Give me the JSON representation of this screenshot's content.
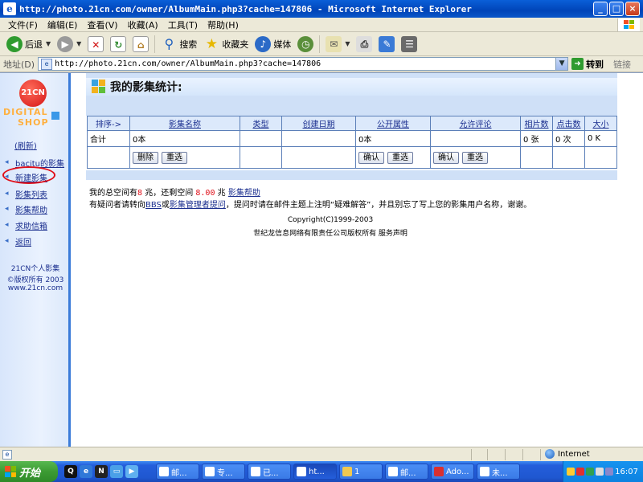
{
  "window": {
    "title": "http://photo.21cn.com/owner/AlbumMain.php3?cache=147806 - Microsoft Internet Explorer"
  },
  "menu": [
    "文件(F)",
    "编辑(E)",
    "查看(V)",
    "收藏(A)",
    "工具(T)",
    "帮助(H)"
  ],
  "toolbar": {
    "back": "后退",
    "search": "搜索",
    "favorites": "收藏夹",
    "media": "媒体"
  },
  "address": {
    "label": "地址(D)",
    "url": "http://photo.21cn.com/owner/AlbumMain.php3?cache=147806",
    "go": "转到",
    "links": "链接"
  },
  "logo": {
    "brand": "21CN",
    "line1": "DIGITAL",
    "line2": "SHOP"
  },
  "sidebar": {
    "refresh": "(刷新)",
    "items": [
      {
        "label": "bacitu的影集"
      },
      {
        "label": "新建影集"
      },
      {
        "label": "影集列表"
      },
      {
        "label": "影集帮助"
      },
      {
        "label": "求助信箱"
      },
      {
        "label": "返回"
      }
    ],
    "footer": [
      "21CN个人影集",
      "©版权所有 2003",
      "www.21cn.com"
    ]
  },
  "main": {
    "title": "我的影集统计:",
    "columns": [
      "排序->",
      "影集名称",
      "类型",
      "创建日期",
      "公开属性",
      "允许评论",
      "相片数",
      "点击数",
      "大小"
    ],
    "summary": {
      "c0": "合计",
      "c1": "0本",
      "c4": "0本",
      "c6": "0 张",
      "c7": "0 次",
      "c8": "0 K"
    },
    "buttons": {
      "delete": "删除",
      "reset": "重选",
      "confirm": "确认"
    },
    "space": {
      "prefix": "我的总空间有",
      "total": "8",
      "mid": " 兆，还剩空间 ",
      "remain": "8.00",
      "suffix": " 兆 ",
      "help_link": "影集帮助"
    },
    "notice": {
      "p1": "有疑问者请转向",
      "bbs": "BBS",
      "p2": "或",
      "admin": "影集管理者提问",
      "p3": "，提问时请在邮件主题上注明“疑难解答”，并且别忘了写上您的影集用户名称，谢谢。"
    },
    "copyright": "Copyright(C)1999-2003",
    "company": "世纪龙信息网络有限责任公司版权所有  服务声明"
  },
  "status": {
    "zone": "Internet"
  },
  "taskbar": {
    "start": "开始",
    "tasks": [
      "邮...",
      "专...",
      "已...",
      "ht...",
      "1",
      "邮...",
      "Ado...",
      "未..."
    ],
    "clock": "16:07"
  }
}
